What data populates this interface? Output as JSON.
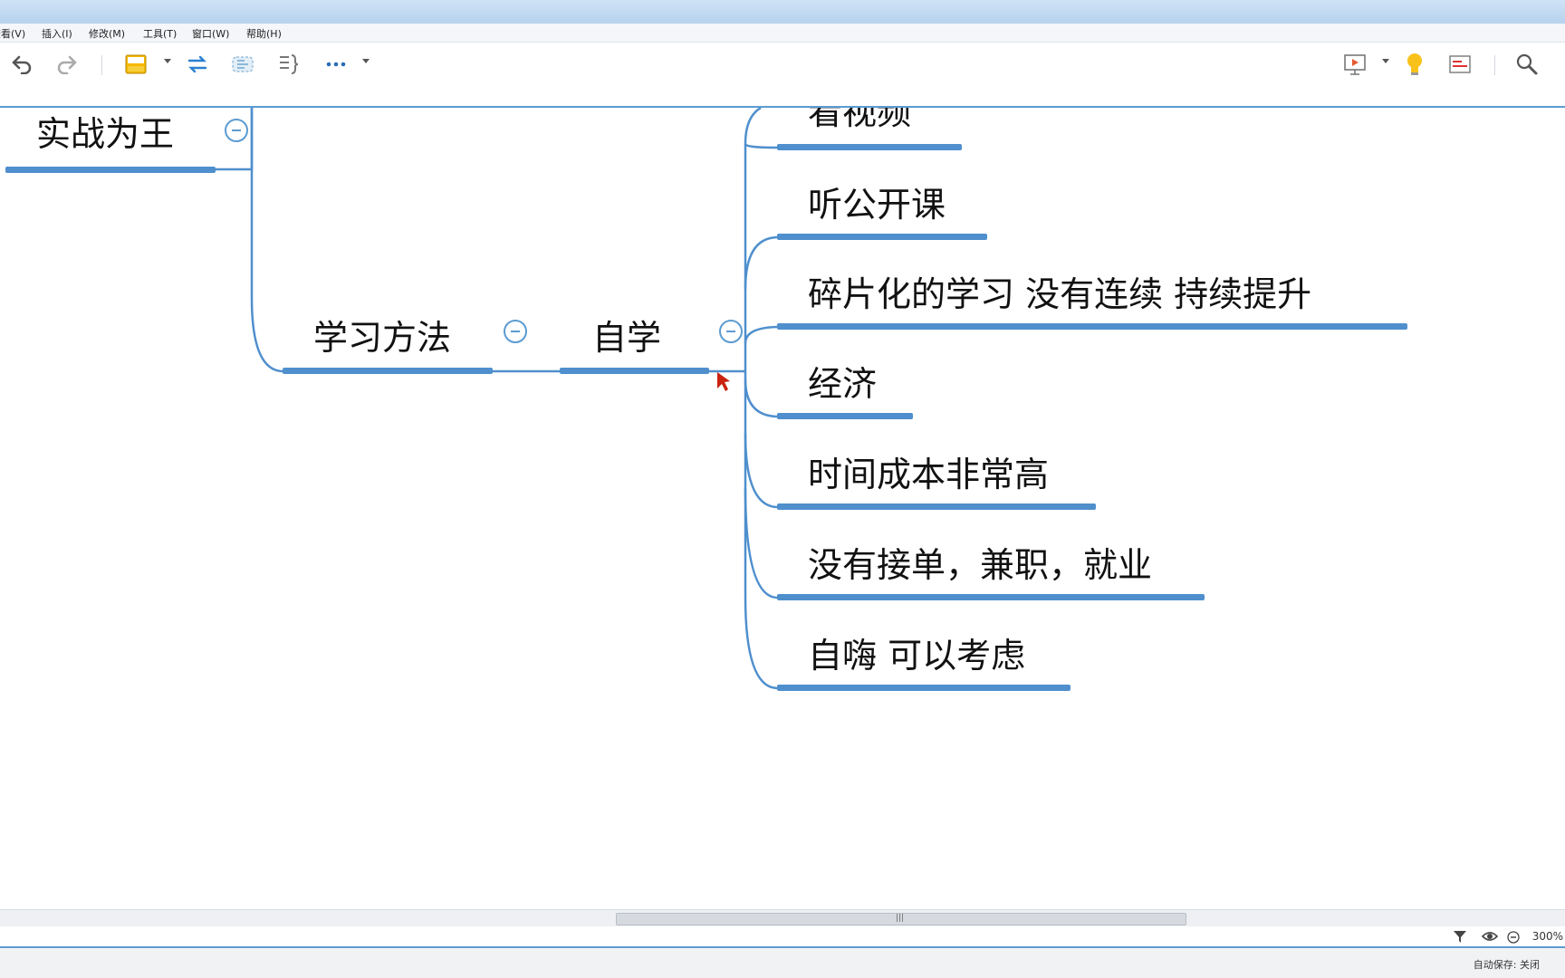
{
  "menu": {
    "items": [
      {
        "id": "view",
        "label": "查看(V)"
      },
      {
        "id": "insert",
        "label": "插入(I)"
      },
      {
        "id": "modify",
        "label": "修改(M)"
      },
      {
        "id": "tools",
        "label": "工具(T)"
      },
      {
        "id": "window",
        "label": "窗口(W)"
      },
      {
        "id": "help",
        "label": "帮助(H)"
      }
    ]
  },
  "toolbar": {
    "icons": [
      "undo-icon",
      "redo-icon",
      "save-icon",
      "relationship-icon",
      "boundary-icon",
      "summary-icon",
      "more-icon",
      "presentation-icon",
      "idea-icon",
      "outline-icon",
      "search-icon"
    ]
  },
  "colors": {
    "accent": "#5c9bd1",
    "node_underline": "#4f8fcd",
    "cursor": "#c9220f"
  },
  "mindmap": {
    "root_partial": {
      "label": "实战为王"
    },
    "branch": {
      "label": "学习方法"
    },
    "subbranch": {
      "label": "自学"
    },
    "leaves": [
      {
        "label": "看视频"
      },
      {
        "label": "听公开课"
      },
      {
        "label": "碎片化的学习   没有连续  持续提升"
      },
      {
        "label": "经济"
      },
      {
        "label": "时间成本非常高"
      },
      {
        "label": "没有接单，兼职，就业"
      },
      {
        "label": "自嗨 可以考虑"
      }
    ]
  },
  "scrollbar": {
    "grip": "|||"
  },
  "status": {
    "zoom": "300%",
    "autosave": "自动保存: 关闭"
  }
}
